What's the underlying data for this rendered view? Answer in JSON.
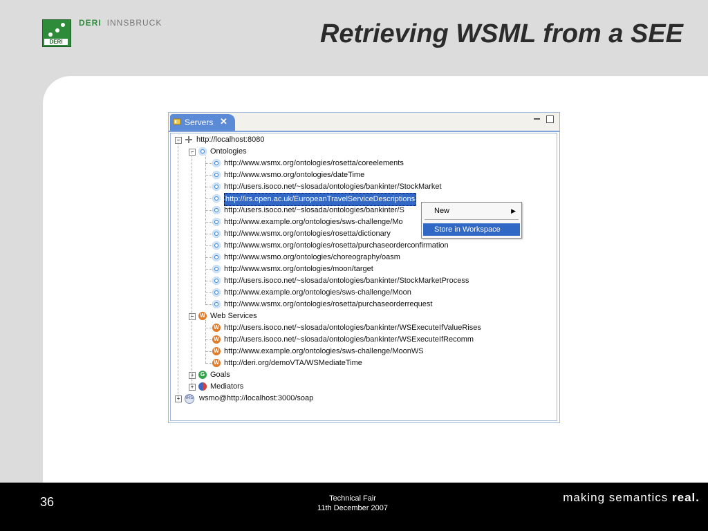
{
  "slide": {
    "brand": {
      "deri": "DERI",
      "place": "INNSBRUCK",
      "logo_text": "DERI"
    },
    "title": "Retrieving WSML from a SEE",
    "footer": {
      "page_number": "36",
      "event": "Technical Fair",
      "date": "11th December 2007",
      "tagline_prefix": "making semantics",
      "tagline_bold": "real."
    }
  },
  "view": {
    "tab_label": "Servers",
    "tree": {
      "server": "http://localhost:8080",
      "ontologies_label": "Ontologies",
      "ontologies": [
        "http://www.wsmx.org/ontologies/rosetta/coreelements",
        "http://www.wsmo.org/ontologies/dateTime",
        "http://users.isoco.net/~slosada/ontologies/bankinter/StockMarket",
        "http://irs.open.ac.uk/EuropeanTravelServiceDescriptions",
        "http://users.isoco.net/~slosada/ontologies/bankinter/S",
        "http://www.example.org/ontologies/sws-challenge/Mo",
        "http://www.wsmx.org/ontologies/rosetta/dictionary",
        "http://www.wsmx.org/ontologies/rosetta/purchaseorderconfirmation",
        "http://www.wsmo.org/ontologies/choreography/oasm",
        "http://www.wsmx.org/ontologies/moon/target",
        "http://users.isoco.net/~slosada/ontologies/bankinter/StockMarketProcess",
        "http://www.example.org/ontologies/sws-challenge/Moon",
        "http://www.wsmx.org/ontologies/rosetta/purchaseorderrequest"
      ],
      "selected_index": 3,
      "web_services_label": "Web Services",
      "web_services": [
        "http://users.isoco.net/~slosada/ontologies/bankinter/WSExecuteIfValueRises",
        "http://users.isoco.net/~slosada/ontologies/bankinter/WSExecuteIfRecomm",
        "http://www.example.org/ontologies/sws-challenge/MoonWS",
        "http://deri.org/demoVTA/WSMediateTime"
      ],
      "goals_label": "Goals",
      "mediators_label": "Mediators",
      "second_server": "wsmo@http://localhost:3000/soap",
      "irs_icon_text": "IRS",
      "ws_icon_text": "W",
      "goal_icon_text": "G"
    },
    "context_menu": {
      "new_label": "New",
      "store_label": "Store in Workspace"
    }
  }
}
